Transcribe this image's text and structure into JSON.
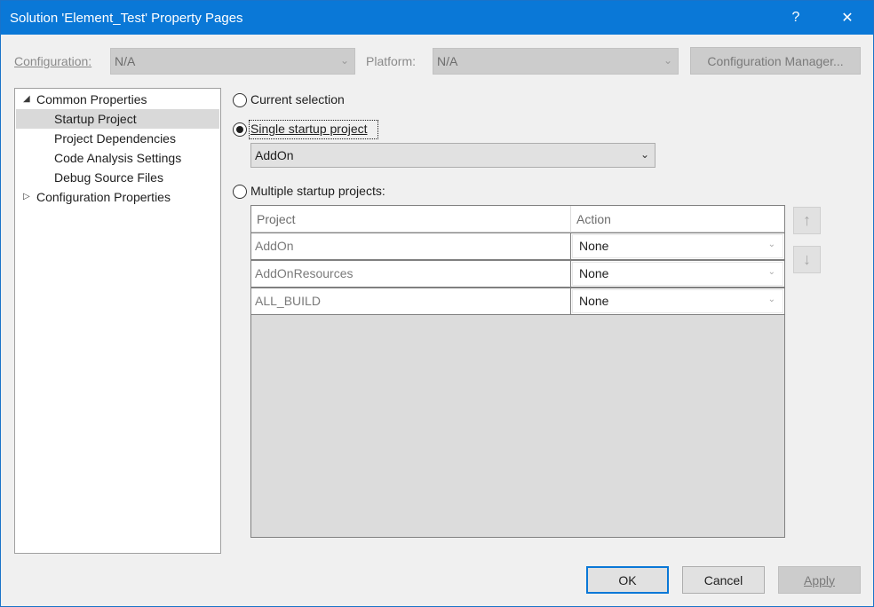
{
  "window": {
    "title": "Solution 'Element_Test' Property Pages",
    "help_glyph": "?",
    "close_glyph": "✕"
  },
  "top_bar": {
    "configuration_label": "Configuration:",
    "configuration_value": "N/A",
    "platform_label": "Platform:",
    "platform_value": "N/A",
    "config_manager_label": "Configuration Manager..."
  },
  "tree": {
    "items": [
      {
        "label": "Common Properties"
      },
      {
        "label": "Startup Project"
      },
      {
        "label": "Project Dependencies"
      },
      {
        "label": "Code Analysis Settings"
      },
      {
        "label": "Debug Source Files"
      },
      {
        "label": "Configuration Properties"
      }
    ],
    "selected": "Startup Project"
  },
  "startup": {
    "current_selection_label": "Current selection",
    "single_label": "Single startup project",
    "single_value": "AddOn",
    "multiple_label": "Multiple startup projects:",
    "selected_option": "Single startup project"
  },
  "grid": {
    "columns": [
      "Project",
      "Action"
    ],
    "rows": [
      {
        "project": "AddOn",
        "action": "None"
      },
      {
        "project": "AddOnResources",
        "action": "None"
      },
      {
        "project": "ALL_BUILD",
        "action": "None"
      }
    ],
    "move_up_glyph": "↑",
    "move_down_glyph": "↓"
  },
  "footer": {
    "ok_label": "OK",
    "cancel_label": "Cancel",
    "apply_label": "Apply"
  },
  "colors": {
    "titlebar": "#0a78d7",
    "default_button_border": "#0a78d7",
    "selection": "#d9d9d9"
  }
}
